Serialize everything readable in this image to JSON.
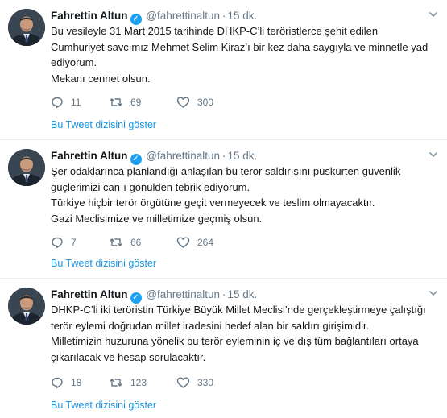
{
  "tweets": [
    {
      "author_name": "Fahrettin Altun",
      "handle": "@fahrettinaltun",
      "time": "15 dk.",
      "lines": [
        "Bu vesileyle 31 Mart 2015 tarihinde DHKP-C’li teröristlerce şehit edilen",
        "Cumhuriyet savcımız Mehmet Selim Kiraz’ı bir kez daha saygıyla ve minnetle yad",
        "ediyorum.",
        "Mekanı cennet olsun."
      ],
      "replies": "11",
      "retweets": "69",
      "likes": "300",
      "thread_link": "Bu Tweet dizisini göster"
    },
    {
      "author_name": "Fahrettin Altun",
      "handle": "@fahrettinaltun",
      "time": "15 dk.",
      "lines": [
        "Şer odaklarınca planlandığı anlaşılan  bu terör saldırısını püskürten güvenlik",
        "güçlerimizi can-ı gönülden tebrik ediyorum.",
        "Türkiye hiçbir terör örgütüne geçit vermeyecek ve teslim olmayacaktır.",
        "Gazi Meclisimize ve milletimize geçmiş olsun."
      ],
      "replies": "7",
      "retweets": "66",
      "likes": "264",
      "thread_link": "Bu Tweet dizisini göster"
    },
    {
      "author_name": "Fahrettin Altun",
      "handle": "@fahrettinaltun",
      "time": "15 dk.",
      "lines": [
        "DHKP-C’li iki teröristin Türkiye Büyük Millet Meclisi’nde gerçekleştirmeye çalıştığı",
        "terör eylemi doğrudan millet iradesini hedef alan bir saldırı girişimidir.",
        "Milletimizin huzuruna yönelik bu terör eyleminin iç ve dış tüm bağlantıları ortaya",
        "çıkarılacak ve hesap sorulacaktır."
      ],
      "replies": "18",
      "retweets": "123",
      "likes": "330",
      "thread_link": "Bu Tweet dizisini göster"
    }
  ],
  "icons": {
    "verified": "verified-badge-icon",
    "caret": "chevron-down-icon",
    "reply": "reply-icon",
    "retweet": "retweet-icon",
    "like": "heart-icon"
  },
  "colors": {
    "link": "#1b95e0",
    "verified": "#1da1f2",
    "muted": "#657786",
    "text": "#14171a",
    "divider": "#e6ecf0"
  }
}
